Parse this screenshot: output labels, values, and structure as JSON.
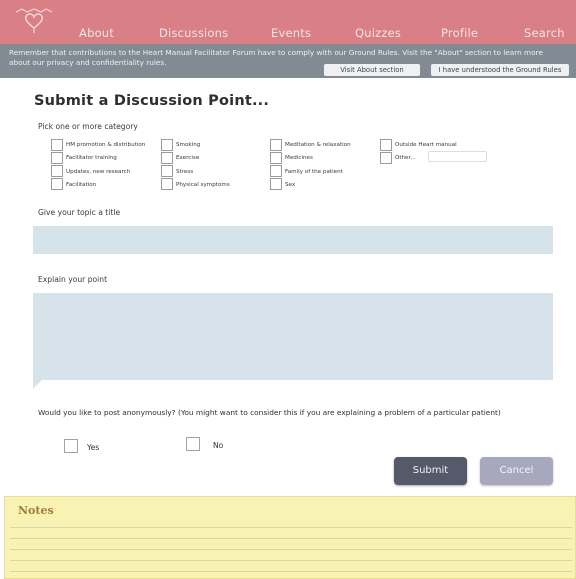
{
  "nav": {
    "items": [
      {
        "label": "About"
      },
      {
        "label": "Discussions"
      },
      {
        "label": "Events"
      },
      {
        "label": "Quizzes"
      },
      {
        "label": "Profile"
      },
      {
        "label": "Search"
      }
    ]
  },
  "notice": {
    "line1": "Remember that contributions to the Heart Manual Facilitator Forum have to comply with our Ground Rules. Visit the \"About\" section to learn more",
    "line2": "about our privacy and confidentiality rules.",
    "visit_about_label": "Visit About section",
    "understood_label": "I have understood the Ground Rules"
  },
  "form": {
    "title": "Submit a Discussion Point...",
    "category_label": "Pick one or more category",
    "categories": [
      {
        "label": "HM promotion & distribution"
      },
      {
        "label": "Facilitator training"
      },
      {
        "label": "Updates, new research"
      },
      {
        "label": "Facilitation"
      },
      {
        "label": "Smoking"
      },
      {
        "label": "Exercise"
      },
      {
        "label": "Stress"
      },
      {
        "label": "Physical symptoms"
      },
      {
        "label": "Meditation & relaxation"
      },
      {
        "label": "Medicines"
      },
      {
        "label": "Family of the patient"
      },
      {
        "label": "Sex"
      },
      {
        "label": "Outside Heart manual"
      },
      {
        "label": "Other..."
      }
    ],
    "topic_title_label": "Give your topic a title",
    "topic_title_value": "",
    "explain_label": "Explain your point",
    "explain_value": "",
    "anonymous_question": "Would you like to post anonymously? (You might want to consider this if you are explaining a problem of a particular patient)",
    "yes_label": "Yes",
    "no_label": "No",
    "submit_label": "Submit",
    "cancel_label": "Cancel"
  },
  "notes": {
    "title": "Notes"
  },
  "colors": {
    "nav_bg": "#d97f86",
    "notice_bg": "#828b94",
    "field_bg": "#d7e3ea",
    "submit_bg": "#545a6a",
    "cancel_bg": "#a7a8bd",
    "notes_bg": "#f8f3b3"
  },
  "icons": {
    "logo": "heart-icon"
  }
}
